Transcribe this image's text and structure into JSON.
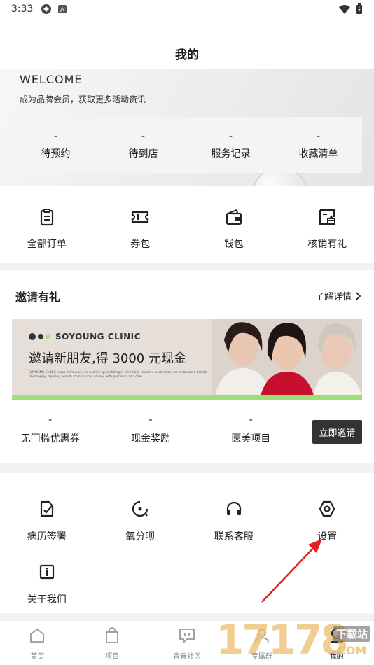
{
  "status_bar": {
    "time": "3:33"
  },
  "header": {
    "title": "我的"
  },
  "welcome": {
    "title": "WELCOME",
    "subtitle": "成为品牌会员，获取更多活动资讯",
    "stats": [
      {
        "value": "-",
        "label": "待预约"
      },
      {
        "value": "-",
        "label": "待到店"
      },
      {
        "value": "-",
        "label": "服务记录"
      },
      {
        "value": "-",
        "label": "收藏清单"
      }
    ]
  },
  "orders": {
    "items": [
      {
        "label": "全部订单",
        "icon": "clipboard-icon"
      },
      {
        "label": "券包",
        "icon": "ticket-icon"
      },
      {
        "label": "钱包",
        "icon": "wallet-icon"
      },
      {
        "label": "核销有礼",
        "icon": "gift-redeem-icon"
      }
    ]
  },
  "invite": {
    "title": "邀请有礼",
    "more_label": "了解详情",
    "banner": {
      "brand": "SOYOUNG CLINIC",
      "headline": "邀请新朋友,得 3000 元现金",
      "fine_print": "SOYOUNG CLINIC is our life's work. As a clinic specializing in minimally invasive aesthetics, we embrace a holistic philosophy, treating beauty from its root causes with precision and care."
    },
    "stats": [
      {
        "value": "-",
        "label": "无门槛优惠券"
      },
      {
        "value": "-",
        "label": "现金奖励"
      },
      {
        "value": "-",
        "label": "医美项目"
      }
    ],
    "button_label": "立即邀请"
  },
  "services": {
    "items": [
      {
        "label": "病历签署",
        "icon": "sign-document-icon"
      },
      {
        "label": "氧分呗",
        "icon": "oxygen-icon"
      },
      {
        "label": "联系客服",
        "icon": "headset-icon"
      },
      {
        "label": "设置",
        "icon": "settings-icon"
      },
      {
        "label": "关于我们",
        "icon": "info-icon"
      }
    ]
  },
  "tabbar": {
    "tabs": [
      {
        "label": "首页",
        "icon": "home-icon"
      },
      {
        "label": "项目",
        "icon": "shopping-bag-icon"
      },
      {
        "label": "青春社区",
        "icon": "chat-icon"
      },
      {
        "label": "专属群",
        "icon": "group-icon"
      },
      {
        "label": "我的",
        "icon": "profile-icon"
      }
    ]
  },
  "watermark": {
    "number": "17178",
    "site": "下载站",
    "domain": ".COM"
  },
  "colors": {
    "accent_dark": "#333333",
    "banner_green": "#9be07a",
    "arrow_red": "#e02020"
  }
}
